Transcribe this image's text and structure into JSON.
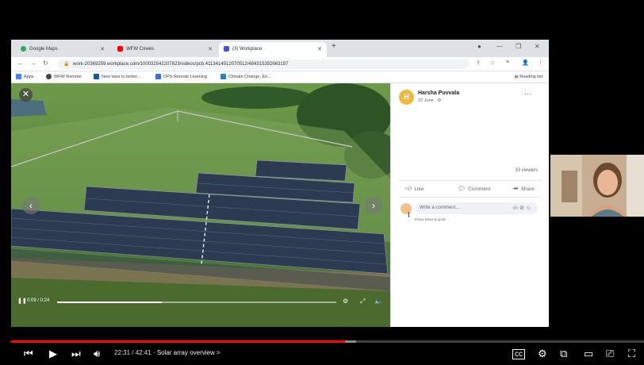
{
  "browser": {
    "tabs": [
      {
        "label": "Google Maps",
        "icon": "maps-pin-icon",
        "color": "#34a853"
      },
      {
        "label": "WFW Cowes",
        "icon": "youtube-icon",
        "color": "#ff0000"
      },
      {
        "label": "(3) Workplace",
        "icon": "workplace-icon",
        "color": "#4a4fd6"
      }
    ],
    "url": "work-20369259.workplace.com/100032542207823/videos/pcb.4113414512070512/484315392663197",
    "bookmarks": [
      {
        "label": "Apps",
        "color": "#4285f4"
      },
      {
        "label": "WFW Remote",
        "color": "#444444"
      },
      {
        "label": "New laws to better...",
        "color": "#1a56a8"
      },
      {
        "label": "DPS Remote Learning",
        "color": "#3a6fd0"
      },
      {
        "label": "Climate Change, En...",
        "color": "#2a7ed3"
      }
    ],
    "reading_list": "Reading list"
  },
  "video": {
    "time": "0:09 / 0:24",
    "progress": 0.375
  },
  "post": {
    "avatar_letter": "H",
    "author": "Harsha Puvvala",
    "date": "22 June · ⚙",
    "more": "···",
    "viewers": "33 viewers",
    "like": "Like",
    "comment": "Comment",
    "share": "Share",
    "comment_placeholder": "Write a comment...",
    "comment_hint": "Press Enter to post."
  },
  "player": {
    "time": "22:31 / 42:41",
    "chapter": "· Solar array overview >",
    "played_fraction": 0.527,
    "loaded_fraction": 0.545,
    "colors": {
      "played": "#ff0000"
    }
  }
}
